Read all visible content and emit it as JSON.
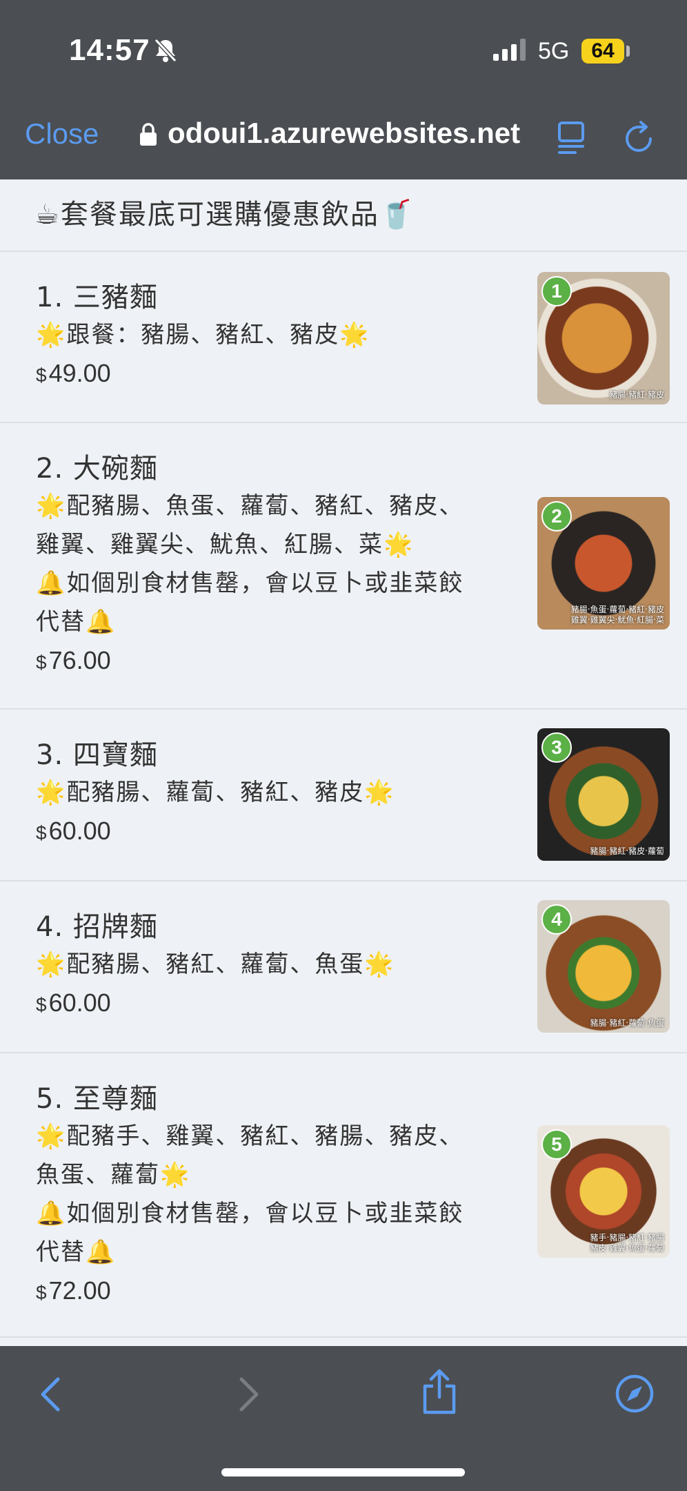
{
  "status_bar": {
    "time": "14:57",
    "network": "5G",
    "battery": "64"
  },
  "browser": {
    "close_label": "Close",
    "url": "odoui1.azurewebsites.net"
  },
  "banner": {
    "text": "☕套餐最底可選購優惠飲品🥤"
  },
  "currency": "$",
  "menu": [
    {
      "title": "1. 三豬麵",
      "desc": [
        "🌟跟餐：豬腸、豬紅、豬皮🌟"
      ],
      "price": "49.00",
      "badge": "1",
      "caption": [
        "豬腸‧豬紅‧豬皮"
      ]
    },
    {
      "title": "2. 大碗麵",
      "desc": [
        "🌟配豬腸、魚蛋、蘿蔔、豬紅、豬皮、雞翼、雞翼尖、魷魚、紅腸、菜🌟",
        "🔔如個別食材售罄，會以豆卜或韭菜餃代替🔔"
      ],
      "price": "76.00",
      "badge": "2",
      "caption": [
        "豬腸‧魚蛋‧蘿蔔‧豬紅‧豬皮",
        "雞翼‧雞翼尖‧魷魚‧紅腸‧菜"
      ]
    },
    {
      "title": "3. 四寶麵",
      "desc": [
        "🌟配豬腸、蘿蔔、豬紅、豬皮🌟"
      ],
      "price": "60.00",
      "badge": "3",
      "caption": [
        "豬腸‧豬紅‧豬皮‧蘿蔔"
      ]
    },
    {
      "title": "4. 招牌麵",
      "desc": [
        "🌟配豬腸、豬紅、蘿蔔、魚蛋🌟"
      ],
      "price": "60.00",
      "badge": "4",
      "caption": [
        "豬腸‧豬紅‧蘿蔔‧魚蛋"
      ]
    },
    {
      "title": "5. 至尊麵",
      "desc": [
        "🌟配豬手、雞翼、豬紅、豬腸、豬皮、魚蛋、蘿蔔🌟",
        "🔔如個別食材售罄，會以豆卜或韭菜餃代替🔔"
      ],
      "price": "72.00",
      "badge": "5",
      "caption": [
        "豬手‧豬腸‧豬紅‧豬腸",
        "豬皮‧雞翼‧魚蛋‧蘿蔔"
      ]
    }
  ],
  "icons": {
    "back": "chevron-left-icon",
    "forward": "chevron-right-icon",
    "share": "share-icon",
    "compass": "compass-icon"
  },
  "colors": {
    "accent": "#5b9bf0",
    "bar_bg": "#4b4e52",
    "page_bg": "#eef1f5",
    "badge": "#5bb046",
    "battery": "#f7d21c"
  }
}
